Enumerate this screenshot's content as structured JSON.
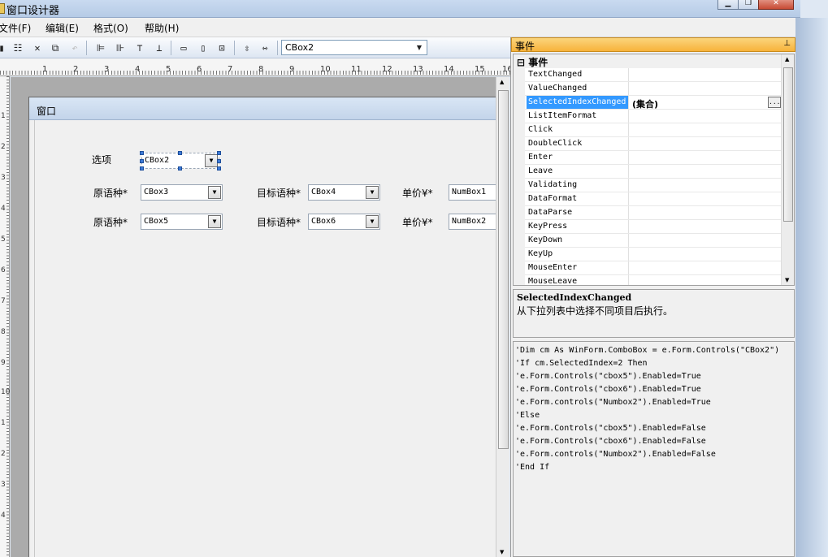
{
  "window": {
    "title": "窗口设计器",
    "buttons": [
      "▁",
      "❐",
      "✕"
    ]
  },
  "menu": {
    "items": [
      "文件(F)",
      "编辑(E)",
      "格式(O)",
      "帮助(H)"
    ]
  },
  "toolbar": {
    "object_select": "CBox2"
  },
  "ruler": {
    "top": [
      "1",
      "2",
      "3",
      "4",
      "5",
      "6",
      "7",
      "8",
      "9",
      "10",
      "11",
      "12",
      "13",
      "14",
      "15",
      "16"
    ],
    "left": [
      "1",
      "2",
      "3",
      "4",
      "5",
      "6",
      "7",
      "8",
      "9",
      "10",
      "1",
      "2",
      "3",
      "4"
    ]
  },
  "form": {
    "title": "窗口",
    "option_label": "选项",
    "option_combo": "CBox2",
    "row1": {
      "src_label": "原语种*",
      "src_combo": "CBox3",
      "tgt_label": "目标语种*",
      "tgt_combo": "CBox4",
      "price_label": "单价¥*",
      "price_box": "NumBox1"
    },
    "row2": {
      "src_label": "原语种*",
      "src_combo": "CBox5",
      "tgt_label": "目标语种*",
      "tgt_combo": "CBox6",
      "price_label": "单价¥*",
      "price_box": "NumBox2"
    }
  },
  "events_panel": {
    "title": "事件",
    "category": "事件",
    "collapse_glyph": "⊟",
    "rows": [
      {
        "name": "TextChanged",
        "value": ""
      },
      {
        "name": "ValueChanged",
        "value": ""
      },
      {
        "name": "SelectedIndexChanged",
        "value": "(集合)"
      },
      {
        "name": "ListItemFormat",
        "value": ""
      },
      {
        "name": "Click",
        "value": ""
      },
      {
        "name": "DoubleClick",
        "value": ""
      },
      {
        "name": "Enter",
        "value": ""
      },
      {
        "name": "Leave",
        "value": ""
      },
      {
        "name": "Validating",
        "value": ""
      },
      {
        "name": "DataFormat",
        "value": ""
      },
      {
        "name": "DataParse",
        "value": ""
      },
      {
        "name": "KeyPress",
        "value": ""
      },
      {
        "name": "KeyDown",
        "value": ""
      },
      {
        "name": "KeyUp",
        "value": ""
      },
      {
        "name": "MouseEnter",
        "value": ""
      },
      {
        "name": "MouseLeave",
        "value": ""
      }
    ],
    "selected_row": "SelectedIndexChanged",
    "more_button": "...",
    "description_title": "SelectedIndexChanged",
    "description_text": "从下拉列表中选择不同项目后执行。",
    "code": "'Dim cm As WinForm.ComboBox = e.Form.Controls(\"CBox2\")\n'If cm.SelectedIndex=2 Then\n'e.Form.Controls(\"cbox5\").Enabled=True\n'e.Form.Controls(\"cbox6\").Enabled=True\n'e.Form.controls(\"Numbox2\").Enabled=True\n'Else\n'e.Form.Controls(\"cbox5\").Enabled=False\n'e.Form.Controls(\"cbox6\").Enabled=False\n'e.Form.controls(\"Numbox2\").Enabled=False\n'End If"
  },
  "colors": {
    "selection": "#3399ff",
    "panel_header": "#f7b23b",
    "handle": "#3d7ad6"
  }
}
